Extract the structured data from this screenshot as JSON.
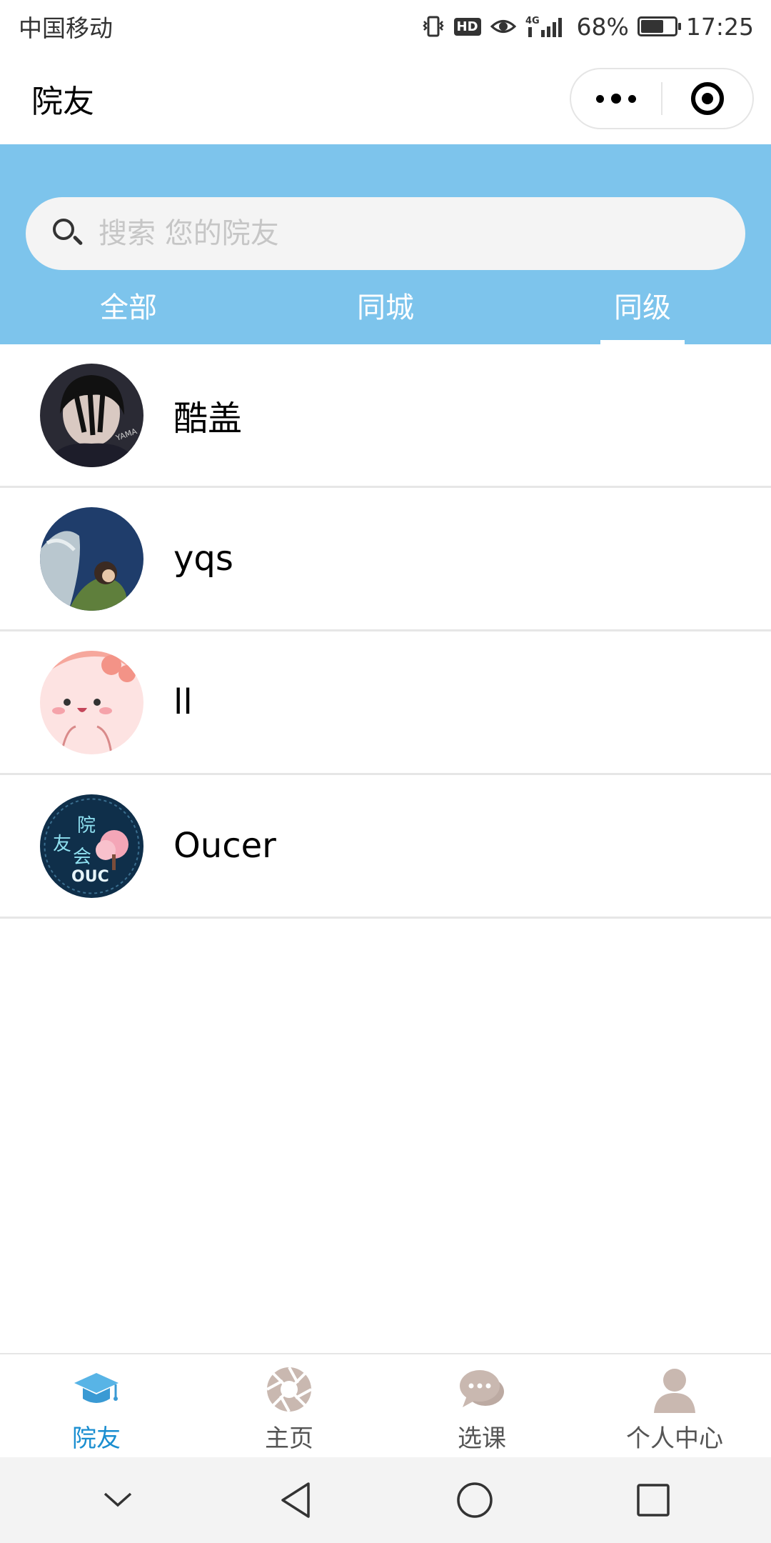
{
  "status_bar": {
    "carrier": "中国移动",
    "hd": "HD",
    "network": "4G",
    "battery": "68%",
    "battery_level": 0.68,
    "time": "17:25"
  },
  "title_bar": {
    "title": "院友"
  },
  "search": {
    "placeholder": "搜索 您的院友"
  },
  "tabs": [
    {
      "label": "全部",
      "active": false
    },
    {
      "label": "同城",
      "active": false
    },
    {
      "label": "同级",
      "active": true
    }
  ],
  "contacts": [
    {
      "name": "酷盖",
      "avatar": "photo-avatar-man"
    },
    {
      "name": "yqs",
      "avatar": "anime-avatar-dragon"
    },
    {
      "name": "ll",
      "avatar": "cartoon-avatar-pink"
    },
    {
      "name": "Oucer",
      "avatar": "logo-avatar-ouc",
      "logo_text": [
        "院",
        "友",
        "会",
        "OUC"
      ]
    }
  ],
  "bottom_tabs": [
    {
      "label": "院友",
      "icon": "graduation-cap-icon",
      "active": true
    },
    {
      "label": "主页",
      "icon": "aperture-icon",
      "active": false
    },
    {
      "label": "选课",
      "icon": "chat-bubbles-icon",
      "active": false
    },
    {
      "label": "个人中心",
      "icon": "person-icon",
      "active": false
    }
  ],
  "colors": {
    "header_blue": "#7dc4ec",
    "active_tab_text": "#1a8ed0",
    "inactive_icon": "#c9b8b0"
  }
}
